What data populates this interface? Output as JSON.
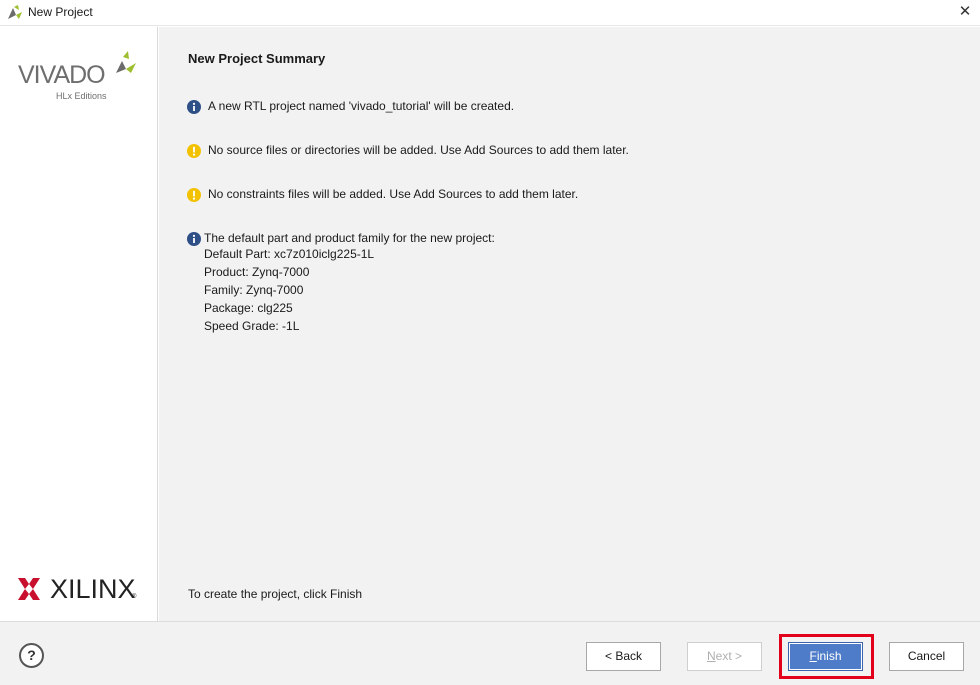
{
  "window": {
    "title": "New Project"
  },
  "branding": {
    "vivado_wordmark": "VIVADO",
    "vivado_edition": "HLx Editions",
    "xilinx_wordmark": "XILINX",
    "xilinx_reg": "®",
    "colors": {
      "vivado_green": "#9dbf2f",
      "xilinx_red": "#c8102e"
    }
  },
  "main": {
    "heading": "New Project Summary",
    "messages": [
      {
        "icon": "info-icon",
        "text": "A new RTL project named 'vivado_tutorial' will be created."
      },
      {
        "icon": "warning-icon",
        "text": "No source files or directories will be added. Use Add Sources to add them later."
      },
      {
        "icon": "warning-icon",
        "text": "No constraints files will be added. Use Add Sources to add them later."
      },
      {
        "icon": "info-icon",
        "text": "The default part and product family for the new project:"
      }
    ],
    "details": [
      "Default Part: xc7z010iclg225-1L",
      "Product: Zynq-7000",
      "Family: Zynq-7000",
      "Package: clg225",
      "Speed Grade: -1L"
    ],
    "footnote": "To create the project, click Finish"
  },
  "footer": {
    "help_label": "?",
    "back_label": "< Back",
    "next_prefix": "N",
    "next_rest": "ext >",
    "finish_prefix": "F",
    "finish_rest": "inish",
    "cancel_label": "Cancel",
    "highlight_color": "#e3001b"
  }
}
